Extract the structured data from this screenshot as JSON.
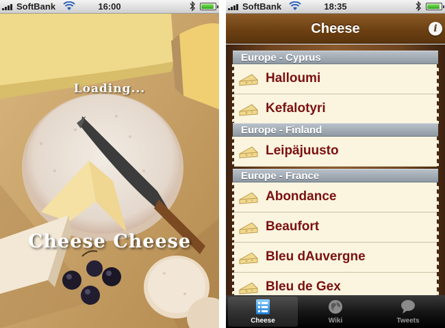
{
  "left_screen": {
    "status": {
      "carrier": "SoftBank",
      "time": "16:00"
    },
    "loading_text": "Loading...",
    "app_title": "Cheese Cheese"
  },
  "right_screen": {
    "status": {
      "carrier": "SoftBank",
      "time": "18:35"
    },
    "nav_title": "Cheese",
    "info_label": "i",
    "sections": [
      {
        "header": "Europe - Cyprus",
        "items": [
          "Halloumi",
          "Kefalotyri"
        ]
      },
      {
        "header": "Europe - Finland",
        "items": [
          "Leipäjuusto"
        ]
      },
      {
        "header": "Europe - France",
        "items": [
          "Abondance",
          "Beaufort",
          "Bleu dAuvergne",
          "Bleu de Gex"
        ]
      }
    ],
    "tabs": [
      {
        "label": "Cheese",
        "icon": "list-icon",
        "selected": true
      },
      {
        "label": "Wiki",
        "icon": "globe-icon",
        "selected": false
      },
      {
        "label": "Tweets",
        "icon": "speech-bubble-icon",
        "selected": false
      }
    ]
  },
  "colors": {
    "nav_brown": "#6b3f12",
    "item_text": "#7a1010",
    "row_paper": "#fbf5e0",
    "section_header": "#9aa3ac"
  }
}
